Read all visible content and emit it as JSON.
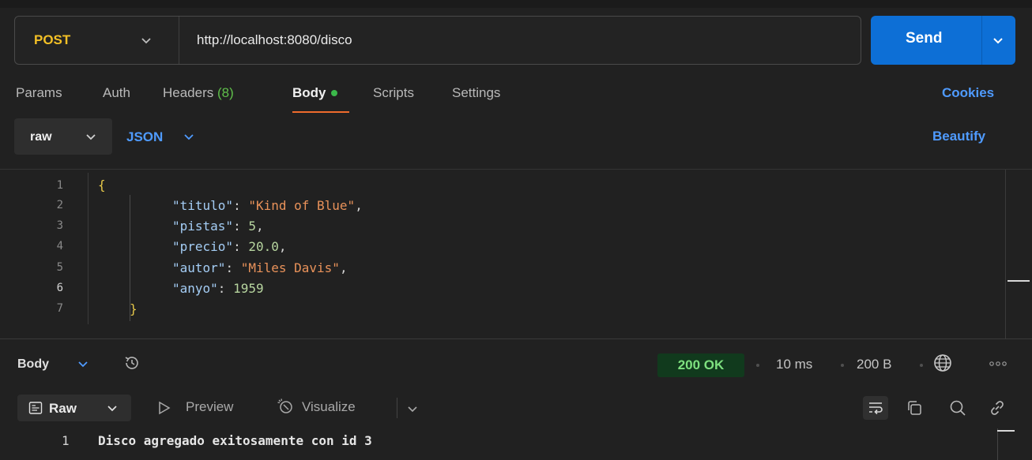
{
  "request": {
    "method": "POST",
    "url": "http://localhost:8080/disco",
    "send_label": "Send"
  },
  "tabs": {
    "params": "Params",
    "auth": "Auth",
    "headers": "Headers",
    "headers_count": "(8)",
    "body": "Body",
    "scripts": "Scripts",
    "settings": "Settings",
    "cookies": "Cookies"
  },
  "body_options": {
    "mode": "raw",
    "language": "JSON",
    "beautify": "Beautify"
  },
  "editor": {
    "line_numbers": [
      "1",
      "2",
      "3",
      "4",
      "5",
      "6",
      "7"
    ],
    "open_brace": "{",
    "close_brace": "}",
    "lines": [
      {
        "key": "\"titulo\"",
        "colon": ": ",
        "value": "\"Kind of Blue\"",
        "trail": ",",
        "value_type": "string"
      },
      {
        "key": "\"pistas\"",
        "colon": ": ",
        "value": "5",
        "trail": ",",
        "value_type": "number"
      },
      {
        "key": "\"precio\"",
        "colon": ": ",
        "value": "20.0",
        "trail": ",",
        "value_type": "number"
      },
      {
        "key": "\"autor\"",
        "colon": ": ",
        "value": "\"Miles Davis\"",
        "trail": ",",
        "value_type": "string"
      },
      {
        "key": "\"anyo\"",
        "colon": ": ",
        "value": "1959",
        "trail": "",
        "value_type": "number"
      }
    ]
  },
  "response": {
    "section_label": "Body",
    "status": "200 OK",
    "time": "10 ms",
    "size": "200 B",
    "view_mode": "Raw",
    "preview": "Preview",
    "visualize": "Visualize",
    "line_number": "1",
    "text": "Disco agregado exitosamente con id 3"
  },
  "colors": {
    "accent": "#0d6fd6",
    "method": "#f3c026",
    "link": "#4f9bff",
    "tab_underline": "#ef6b2c",
    "status_bg": "#113a1d",
    "status_text": "#7ee07f"
  },
  "icons": [
    "chevron-down-icon",
    "history-icon",
    "globe-icon",
    "more-icon",
    "raw-doc-icon",
    "play-icon",
    "visualize-icon",
    "wrap-icon",
    "copy-icon",
    "search-icon",
    "link-icon"
  ]
}
